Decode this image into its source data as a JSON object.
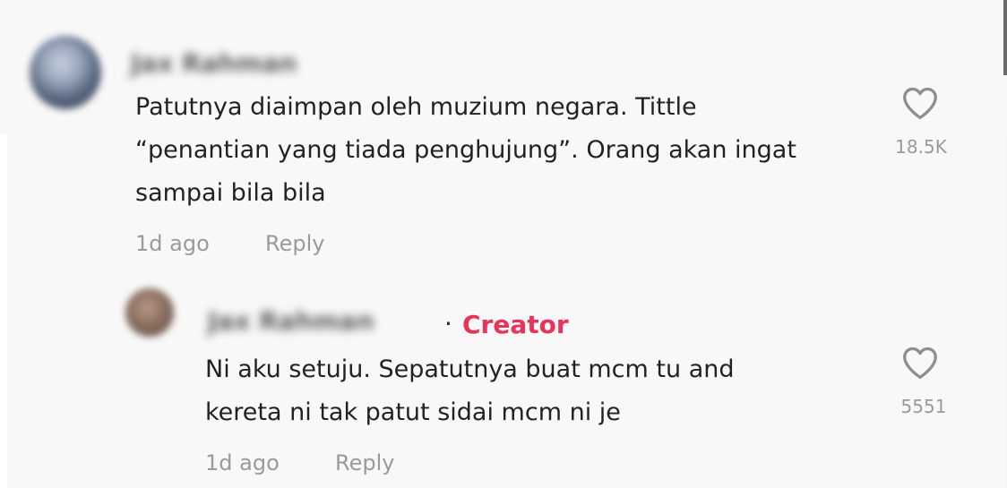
{
  "comment": {
    "author": "Jax Rahman",
    "text_line1": "Patutnya diaimpan oleh muzium negara. Tittle",
    "text_line2": "“penantian yang tiada penghujung”. Orang akan ingat",
    "text_line3": "sampai bila bila",
    "time": "1d ago",
    "reply_label": "Reply",
    "likes": "18.5K",
    "icon": "heart-outline-icon"
  },
  "reply": {
    "author": "Jax Rahman",
    "badge_separator": "·",
    "badge": "Creator",
    "badge_color": "#e8345b",
    "text_line1": "Ni aku setuju. Sepatutnya buat mcm tu and",
    "text_line2": "kereta ni tak patut sidai mcm ni je",
    "time": "1d ago",
    "reply_label": "Reply",
    "likes": "5551",
    "icon": "heart-outline-icon"
  }
}
